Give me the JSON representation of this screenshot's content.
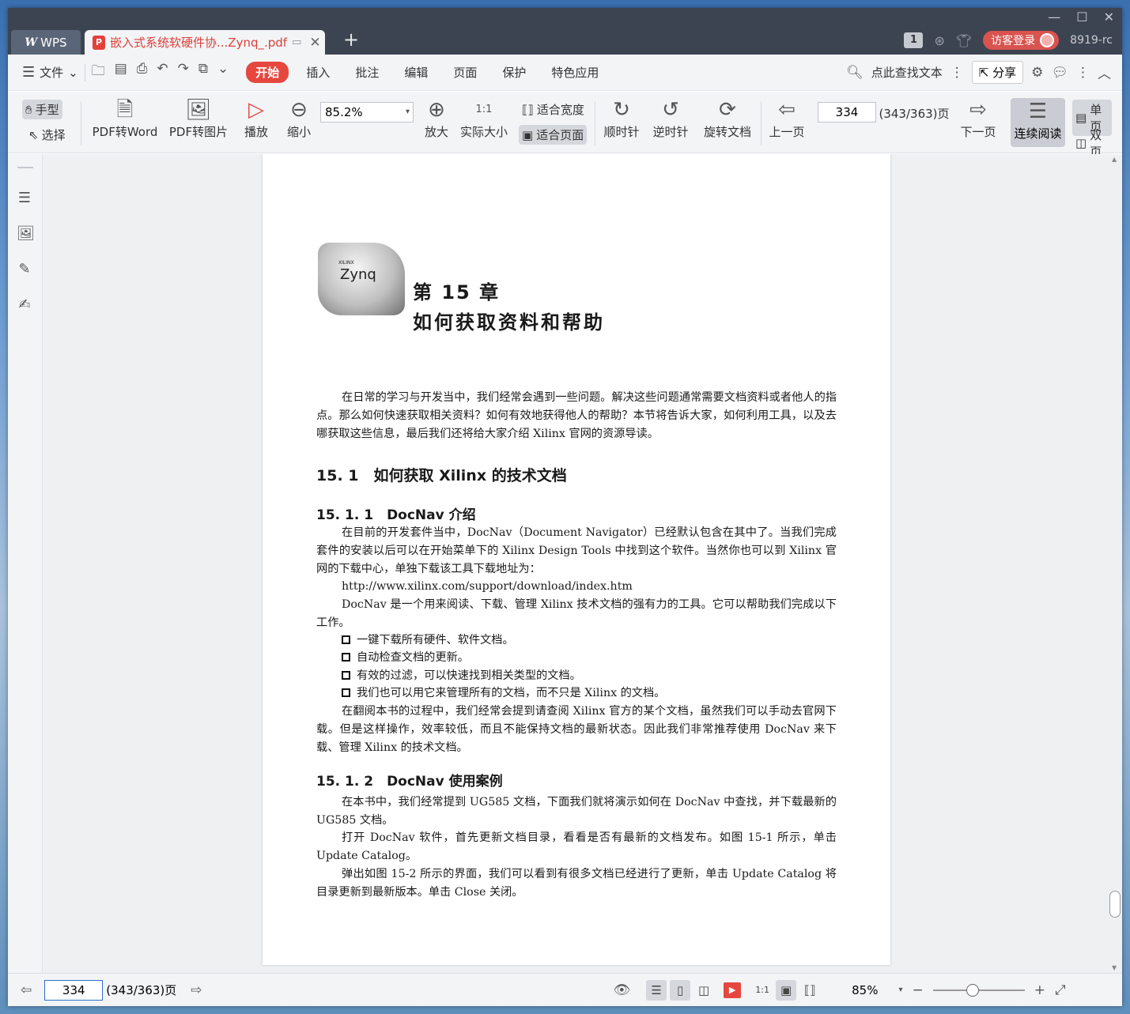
{
  "titlebar": {
    "wps_tab": "WPS",
    "wps_logo": "W",
    "doc_tab": "嵌入式系统软硬件协...Zynq_.pdf",
    "pdf_glyph": "P",
    "close": "✕",
    "new_tab": "+",
    "window_min": "—",
    "window_max": "☐",
    "window_close": "✕",
    "badge": "1",
    "login": "访客登录",
    "user": "8919-rc"
  },
  "menubar": {
    "hamburger": "☰",
    "file": "文件",
    "file_caret": "⌄",
    "items": [
      "开始",
      "插入",
      "批注",
      "编辑",
      "页面",
      "保护",
      "特色应用"
    ],
    "search": "点此查找文本",
    "share": "分享"
  },
  "toolbar": {
    "hand": "手型",
    "select": "选择",
    "pdf_to_word": "PDF转Word",
    "pdf_to_image": "PDF转图片",
    "play": "播放",
    "zoom_out": "缩小",
    "zoom_value": "85.2%",
    "zoom_caret": "▾",
    "zoom_in": "放大",
    "actual_size": "实际大小",
    "actual_size_glyph": "1:1",
    "fit_width": "适合宽度",
    "fit_page": "适合页面",
    "clockwise": "顺时针",
    "counterclockwise": "逆时针",
    "rotate_doc": "旋转文档",
    "prev_page": "上一页",
    "page_input": "334",
    "page_total": "(343/363)页",
    "next_page": "下一页",
    "continuous": "连续阅读",
    "single": "单页",
    "double": "双页"
  },
  "document": {
    "logo_small": "XILINX",
    "logo_text": "Zynq",
    "chapter_num": "第 15 章",
    "chapter_title": "如何获取资料和帮助",
    "intro": "在日常的学习与开发当中，我们经常会遇到一些问题。解决这些问题通常需要文档资料或者他人的指点。那么如何快速获取相关资料？如何有效地获得他人的帮助？本节将告诉大家，如何利用工具，以及去哪获取这些信息，最后我们还将给大家介绍 Xilinx 官网的资源导读。",
    "h2": "15. 1　如何获取 Xilinx 的技术文档",
    "h3_1": "15. 1. 1　DocNav 介绍",
    "p1": "在目前的开发套件当中，DocNav（Document Navigator）已经默认包含在其中了。当我们完成套件的安装以后可以在开始菜单下的 Xilinx Design Tools 中找到这个软件。当然你也可以到 Xilinx 官网的下载中心，单独下载该工具下载地址为：",
    "url": "http://www.xilinx.com/support/download/index.htm",
    "p2": "DocNav 是一个用来阅读、下载、管理 Xilinx 技术文档的强有力的工具。它可以帮助我们完成以下工作。",
    "bullets": [
      "一键下载所有硬件、软件文档。",
      "自动检查文档的更新。",
      "有效的过滤，可以快速找到相关类型的文档。",
      "我们也可以用它来管理所有的文档，而不只是 Xilinx 的文档。"
    ],
    "p3": "在翻阅本书的过程中，我们经常会提到请查阅 Xilinx 官方的某个文档，虽然我们可以手动去官网下载。但是这样操作，效率较低，而且不能保持文档的最新状态。因此我们非常推荐使用 DocNav 来下载、管理 Xilinx 的技术文档。",
    "h3_2": "15. 1. 2　DocNav 使用案例",
    "p4": "在本书中，我们经常提到 UG585 文档，下面我们就将演示如何在 DocNav 中查找，并下载最新的 UG585 文档。",
    "p5": "打开 DocNav 软件，首先更新文档目录，看看是否有最新的文档发布。如图 15-1 所示，单击 Update Catalog。",
    "p6": "弹出如图 15-2 所示的界面，我们可以看到有很多文档已经进行了更新，单击 Update Catalog 将目录更新到最新版本。单击 Close 关闭。"
  },
  "statusbar": {
    "page_input": "334",
    "page_total": "(343/363)页",
    "zoom": "85%",
    "zoom_caret": "▾",
    "actual_size_glyph": "1:1"
  },
  "colors": {
    "accent": "#e5473f",
    "titlebar": "#3d4451"
  }
}
